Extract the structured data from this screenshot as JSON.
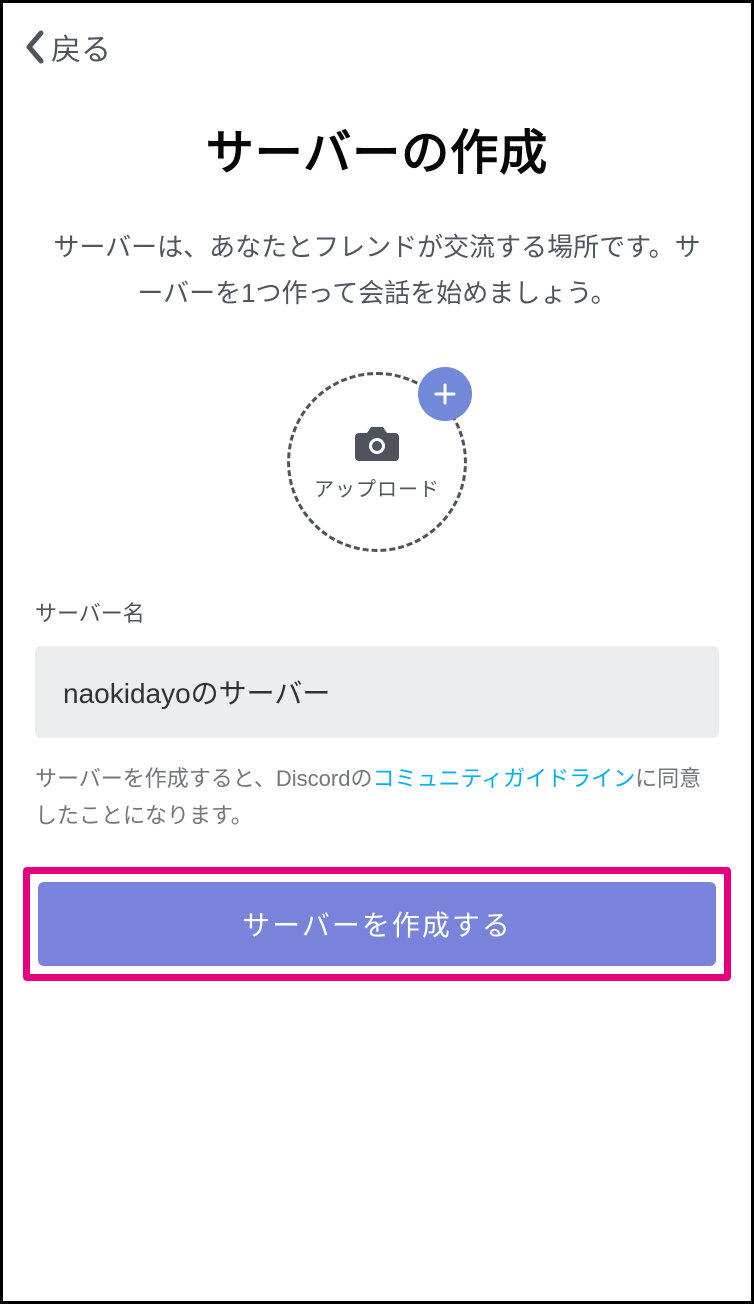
{
  "header": {
    "back_label": "戻る"
  },
  "title": "サーバーの作成",
  "subtitle": "サーバーは、あなたとフレンドが交流する場所です。サーバーを1つ作って会話を始めましょう。",
  "upload": {
    "label": "アップロード"
  },
  "form": {
    "server_name_label": "サーバー名",
    "server_name_value": "naokidayoのサーバー"
  },
  "disclaimer": {
    "prefix": "サーバーを作成すると、Discordの",
    "link_text": "コミュニティガイドライン",
    "suffix": "に同意したことになります。"
  },
  "create_button_label": "サーバーを作成する",
  "colors": {
    "accent": "#7289da",
    "highlight": "#e6007e",
    "link": "#00aff4"
  }
}
